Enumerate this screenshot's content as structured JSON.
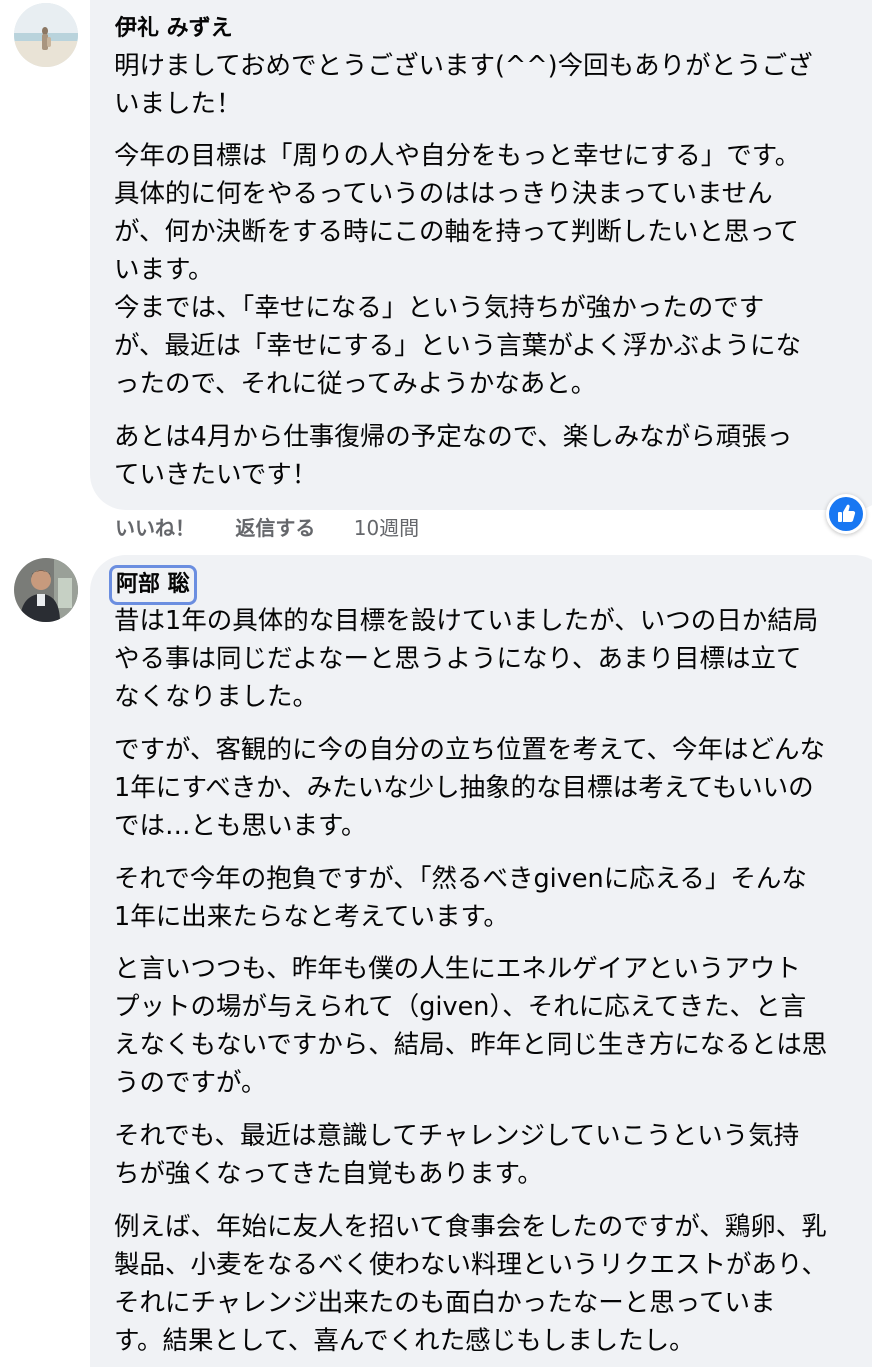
{
  "comments": [
    {
      "author": "伊礼 みずえ",
      "avatar_icon": "beach-photo-avatar",
      "paragraphs": [
        [
          "明けましておめでとうございます(^^)今回もありがとうござ",
          "いました！"
        ],
        [
          "今年の目標は「周りの人や自分をもっと幸せにする」です。",
          "具体的に何をやるっていうのははっきり決まっていません",
          "が、何か決断をする時にこの軸を持って判断したいと思って",
          "います。",
          "今までは、「幸せになる」という気持ちが強かったのです",
          "が、最近は「幸せにする」という言葉がよく浮かぶようにな",
          "ったので、それに従ってみようかなあと。"
        ],
        [
          "あとは4月から仕事復帰の予定なので、楽しみながら頑張っ",
          "ていきたいです！"
        ]
      ],
      "actions": {
        "like_label": "いいね！",
        "reply_label": "返信する",
        "timestamp": "10週間"
      },
      "reaction_icon": "like-thumbs-up"
    },
    {
      "author": "阿部 聡",
      "avatar_icon": "person-photo-avatar",
      "paragraphs": [
        [
          "昔は1年の具体的な目標を設けていましたが、いつの日か結局",
          "やる事は同じだよなーと思うようになり、あまり目標は立て",
          "なくなりました。"
        ],
        [
          "ですが、客観的に今の自分の立ち位置を考えて、今年はどんな",
          "1年にすべきか、みたいな少し抽象的な目標は考えてもいいの",
          "では…とも思います。"
        ],
        [
          "それで今年の抱負ですが、「然るべきgivenに応える」そんな",
          "1年に出来たらなと考えています。"
        ],
        [
          "と言いつつも、昨年も僕の人生にエネルゲイアというアウト",
          "プットの場が与えられて（given）、それに応えてきた、と言",
          "えなくもないですから、結局、昨年と同じ生き方になるとは思",
          "うのですが。"
        ],
        [
          "それでも、最近は意識してチャレンジしていこうという気持",
          "ちが強くなってきた自覚もあります。"
        ],
        [
          "例えば、年始に友人を招いて食事会をしたのですが、鶏卵、乳",
          "製品、小麦をなるべく使わない料理というリクエストがあり、",
          "それにチャレンジ出来たのも面白かったなーと思っていま",
          "す。結果として、喜んでくれた感じもしましたし。"
        ]
      ]
    }
  ],
  "colors": {
    "bubble": "#f0f2f5",
    "text": "#050505",
    "secondary_text": "#65676b",
    "like_blue": "#1877f2",
    "highlight_outline": "#6b8ee0"
  }
}
